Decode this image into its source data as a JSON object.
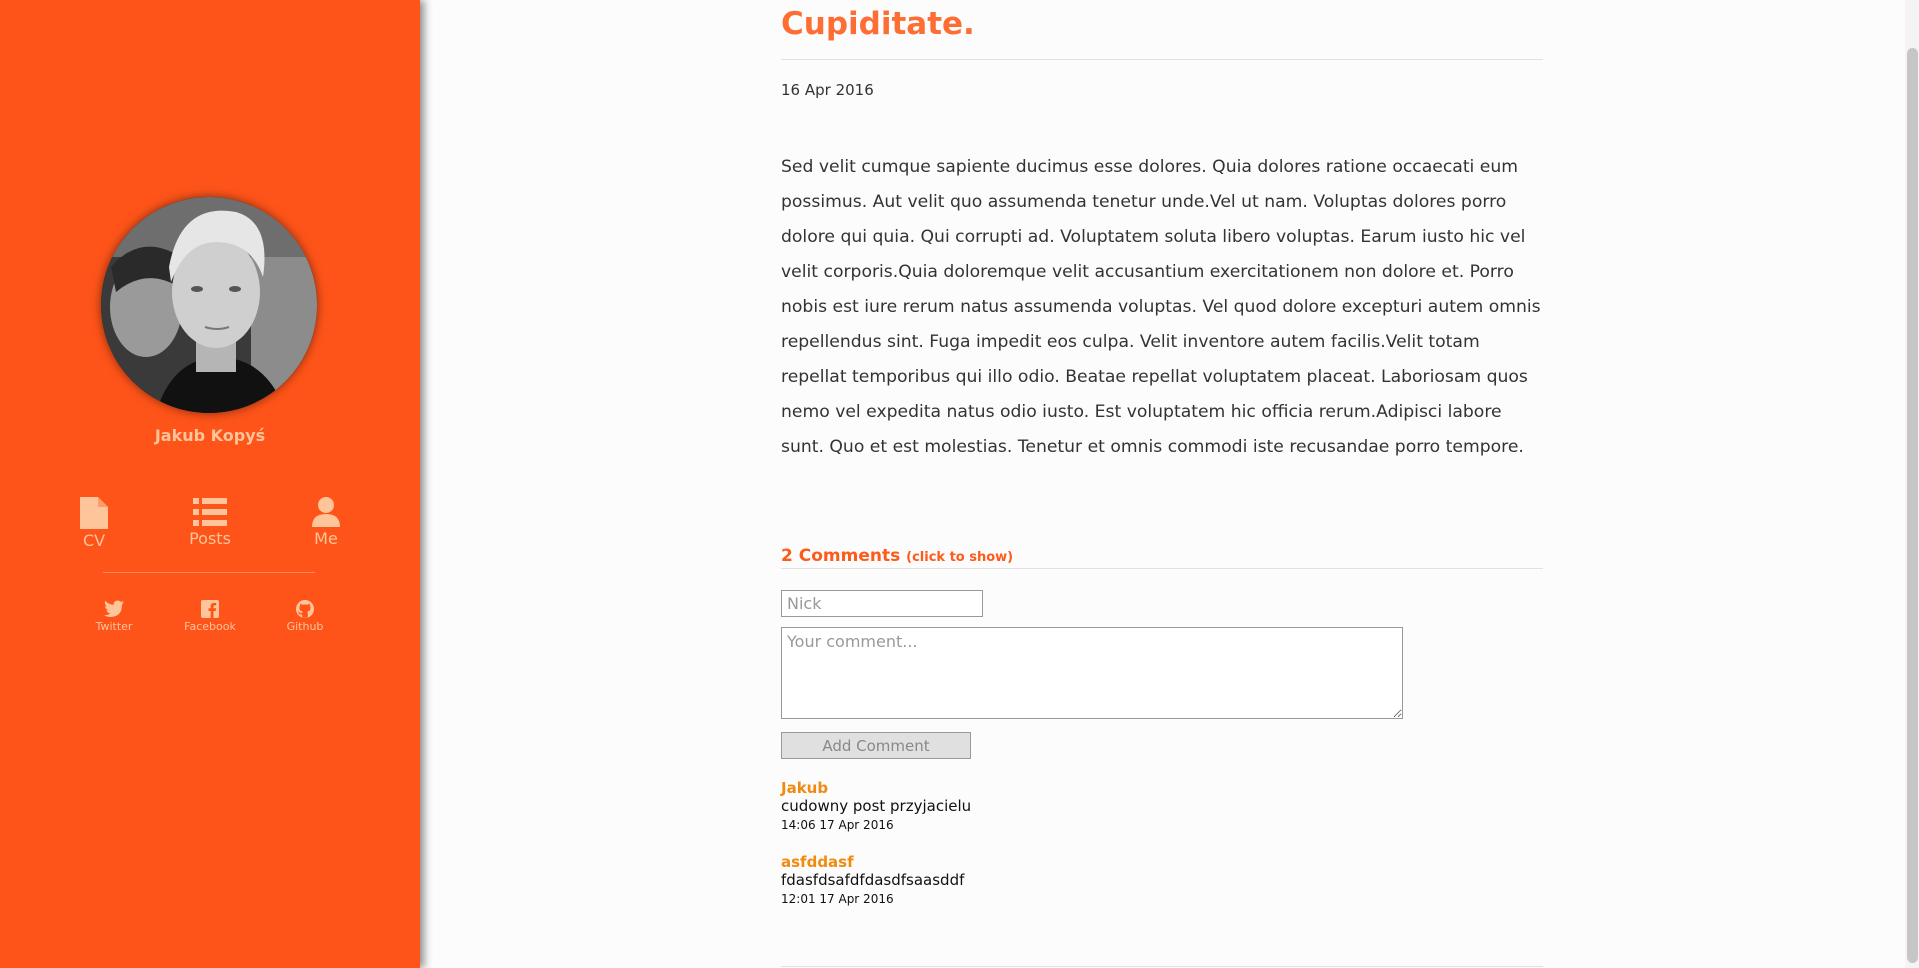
{
  "sidebar": {
    "author_name": "Jakub Kopyś",
    "nav": [
      {
        "label": "CV",
        "icon": "file-icon"
      },
      {
        "label": "Posts",
        "icon": "list-icon"
      },
      {
        "label": "Me",
        "icon": "user-icon"
      }
    ],
    "social": [
      {
        "label": "Twitter",
        "icon": "twitter-icon"
      },
      {
        "label": "Facebook",
        "icon": "facebook-icon"
      },
      {
        "label": "Github",
        "icon": "github-icon"
      }
    ]
  },
  "post": {
    "title": "Cupiditate.",
    "date": "16 Apr 2016",
    "body": "Sed velit cumque sapiente ducimus esse dolores. Quia dolores ratione occaecati eum possimus. Aut velit quo assumenda tenetur unde.Vel ut nam. Voluptas dolores porro dolore qui quia. Qui corrupti ad. Voluptatem soluta libero voluptas. Earum iusto hic vel velit corporis.Quia doloremque velit accusantium exercitationem non dolore et. Porro nobis est iure rerum natus assumenda voluptas. Vel quod dolore excepturi autem omnis repellendus sint. Fuga impedit eos culpa. Velit inventore autem facilis.Velit totam repellat temporibus qui illo odio. Beatae repellat voluptatem placeat. Laboriosam quos nemo vel expedita natus odio iusto. Est voluptatem hic officia rerum.Adipisci labore sunt. Quo et est molestias. Tenetur et omnis commodi iste recusandae porro tempore."
  },
  "comments": {
    "heading": "2 Comments",
    "toggle_hint": "(click to show)",
    "nick_placeholder": "Nick",
    "comment_placeholder": "Your comment...",
    "add_button": "Add Comment",
    "items": [
      {
        "author": "Jakub",
        "text": "cudowny post przyjacielu",
        "time": "14:06 17 Apr 2016"
      },
      {
        "author": "asfddasf",
        "text": "fdasfdsafdfdasdfsaasddf",
        "time": "12:01 17 Apr 2016"
      }
    ]
  },
  "colors": {
    "sidebar_bg": "#ff5419",
    "sidebar_text": "#ffc59a",
    "title": "#fe6e34",
    "comment_author": "#f28a10"
  }
}
